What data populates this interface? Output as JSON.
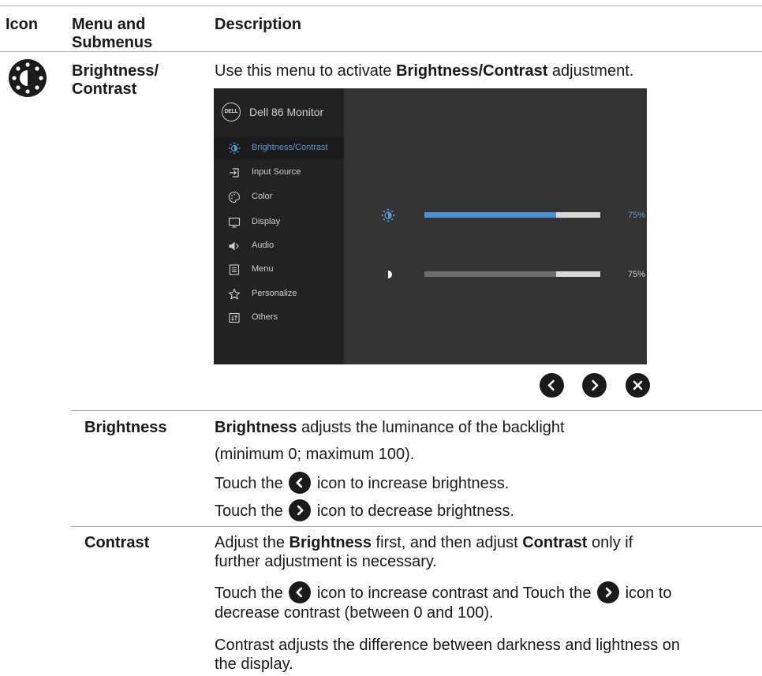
{
  "header": {
    "col_icon": "Icon",
    "col_menu": "Menu and Submenus",
    "col_desc": "Description"
  },
  "brightness_contrast": {
    "menu_label_line1": "Brightness/",
    "menu_label_line2": "Contrast",
    "intro_pre": "Use this menu to activate ",
    "intro_bold": "Brightness/Contrast",
    "intro_post": " adjustment.",
    "icon": "brightness-contrast-icon"
  },
  "osd": {
    "title": "Dell 86 Monitor",
    "logo": "DELL",
    "menu_items": [
      {
        "label": "Brightness/Contrast",
        "icon": "brightness-icon",
        "selected": true
      },
      {
        "label": "Input Source",
        "icon": "input-source-icon",
        "selected": false
      },
      {
        "label": "Color",
        "icon": "color-palette-icon",
        "selected": false
      },
      {
        "label": "Display",
        "icon": "display-icon",
        "selected": false
      },
      {
        "label": "Audio",
        "icon": "speaker-icon",
        "selected": false
      },
      {
        "label": "Menu",
        "icon": "menu-list-icon",
        "selected": false
      },
      {
        "label": "Personalize",
        "icon": "star-icon",
        "selected": false
      },
      {
        "label": "Others",
        "icon": "others-icon",
        "selected": false
      }
    ],
    "brightness": {
      "value": 0.75,
      "label": "75%",
      "accent": "#4a90d9"
    },
    "contrast": {
      "value": 0.75,
      "label": "75%",
      "accent": "#6e6e6e"
    },
    "nav_buttons": [
      "back-chevron-icon",
      "forward-chevron-icon",
      "close-icon"
    ]
  },
  "brightness_row": {
    "title": "Brightness",
    "line1_bold": "Brightness",
    "line1_rest": " adjusts the luminance of the backlight",
    "line2": "(minimum 0; maximum 100).",
    "line3_pre": "Touch the ",
    "line3_post": " icon to increase brightness.",
    "line4_pre": "Touch the ",
    "line4_post": " icon to decrease brightness."
  },
  "contrast_row": {
    "title": "Contrast",
    "p1_a": "Adjust the ",
    "p1_b": "Brightness",
    "p1_c": " first, and then adjust ",
    "p1_d": "Contrast",
    "p1_e": " only if",
    "p1_line2": "further adjustment is necessary.",
    "p2_a": "Touch the ",
    "p2_b": " icon to increase contrast and Touch the ",
    "p2_c": " icon to",
    "p2_line2": "decrease contrast (between 0 and 100).",
    "p3_line1": "Contrast adjusts the difference between darkness and lightness on",
    "p3_line2": "the display."
  }
}
